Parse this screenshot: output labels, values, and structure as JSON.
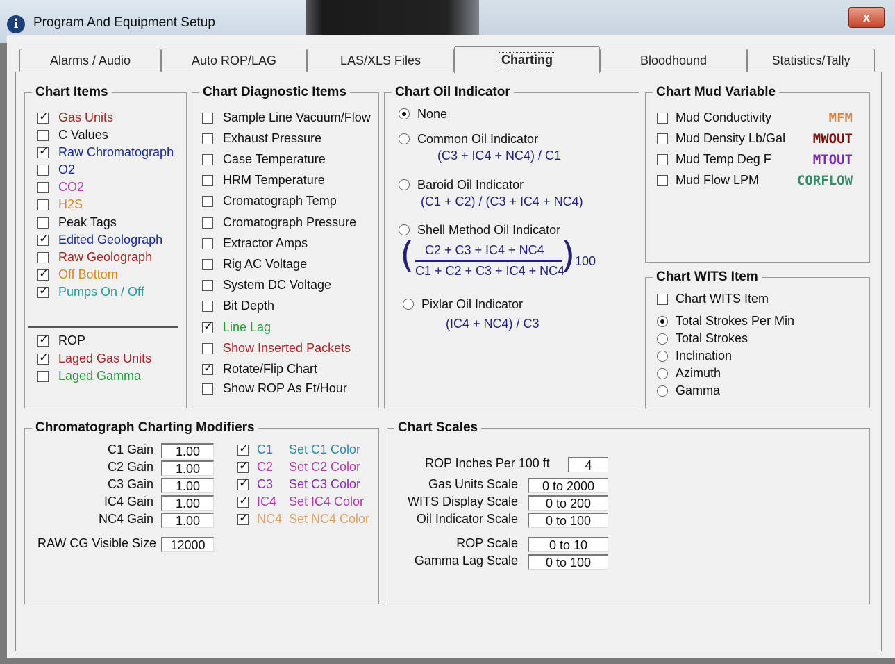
{
  "window": {
    "title": "Program And Equipment Setup",
    "close_glyph": "x"
  },
  "tabs": [
    {
      "label": "Alarms / Audio",
      "active": false
    },
    {
      "label": "Auto ROP/LAG",
      "active": false
    },
    {
      "label": "LAS/XLS Files",
      "active": false
    },
    {
      "label": "Charting",
      "active": true
    },
    {
      "label": "Bloodhound",
      "active": false
    },
    {
      "label": "Statistics/Tally",
      "active": false
    }
  ],
  "chart_items": {
    "title": "Chart Items",
    "items": [
      {
        "label": "Gas Units",
        "checked": true,
        "color": "#a02828"
      },
      {
        "label": "C Values",
        "checked": false,
        "color": "#111111"
      },
      {
        "label": "Raw Chromatograph",
        "checked": true,
        "color": "#1a2a8a"
      },
      {
        "label": "O2",
        "checked": false,
        "color": "#1a2a8a"
      },
      {
        "label": "CO2",
        "checked": false,
        "color": "#b03aa8"
      },
      {
        "label": "H2S",
        "checked": false,
        "color": "#d08a20"
      },
      {
        "label": "Peak Tags",
        "checked": false,
        "color": "#111111"
      },
      {
        "label": "Edited Geolograph",
        "checked": true,
        "color": "#1a2a8a"
      },
      {
        "label": "Raw Geolograph",
        "checked": false,
        "color": "#a02828"
      },
      {
        "label": "Off Bottom",
        "checked": true,
        "color": "#d08a20"
      },
      {
        "label": "Pumps On / Off",
        "checked": true,
        "color": "#2a9a9a"
      }
    ],
    "items2": [
      {
        "label": "ROP",
        "checked": true,
        "color": "#111111"
      },
      {
        "label": "Laged Gas Units",
        "checked": true,
        "color": "#a02828"
      },
      {
        "label": "Laged Gamma",
        "checked": false,
        "color": "#2a9a3a"
      }
    ]
  },
  "diagnostic": {
    "title": "Chart Diagnostic Items",
    "items": [
      {
        "label": "Sample Line Vacuum/Flow",
        "checked": false,
        "color": "#111111"
      },
      {
        "label": "Exhaust Pressure",
        "checked": false,
        "color": "#111111"
      },
      {
        "label": "Case Temperature",
        "checked": false,
        "color": "#111111"
      },
      {
        "label": "HRM Temperature",
        "checked": false,
        "color": "#111111"
      },
      {
        "label": "Cromatograph Temp",
        "checked": false,
        "color": "#111111"
      },
      {
        "label": "Cromatograph Pressure",
        "checked": false,
        "color": "#111111"
      },
      {
        "label": "Extractor Amps",
        "checked": false,
        "color": "#111111"
      },
      {
        "label": "Rig AC Voltage",
        "checked": false,
        "color": "#111111"
      },
      {
        "label": "System DC Voltage",
        "checked": false,
        "color": "#111111"
      },
      {
        "label": "Bit Depth",
        "checked": false,
        "color": "#111111"
      },
      {
        "label": "Line Lag",
        "checked": true,
        "color": "#2a9a3a"
      },
      {
        "label": "Show Inserted Packets",
        "checked": false,
        "color": "#a02828"
      },
      {
        "label": "Rotate/Flip Chart",
        "checked": true,
        "color": "#111111"
      },
      {
        "label": "Show ROP As Ft/Hour",
        "checked": false,
        "color": "#111111"
      }
    ]
  },
  "oil": {
    "title": "Chart Oil Indicator",
    "none_label": "None",
    "common_label": "Common Oil Indicator",
    "common_formula": "(C3 + IC4 + NC4) / C1",
    "baroid_label": "Baroid Oil Indicator",
    "baroid_formula": "(C1 + C2) / (C3 + IC4 + NC4)",
    "shell_label": "Shell Method Oil Indicator",
    "shell_num": "C2 + C3 + IC4 + NC4",
    "shell_den": "C1 + C2 + C3 + IC4 + NC4",
    "shell_mult": "100",
    "pixlar_label": "Pixlar Oil Indicator",
    "pixlar_formula": "(IC4 + NC4) / C3",
    "selected": "None"
  },
  "mud": {
    "title": "Chart Mud Variable",
    "items": [
      {
        "label": "Mud Conductivity",
        "code": "MFM",
        "code_color": "#e0853a",
        "checked": false
      },
      {
        "label": "Mud Density Lb/Gal",
        "code": "MWOUT",
        "code_color": "#7a1010",
        "checked": false
      },
      {
        "label": "Mud Temp Deg F",
        "code": "MTOUT",
        "code_color": "#7a2aaa",
        "checked": false
      },
      {
        "label": "Mud Flow LPM",
        "code": "CORFLOW",
        "code_color": "#3a8a6a",
        "checked": false
      }
    ]
  },
  "wits": {
    "title": "Chart WITS Item",
    "checkbox_label": "Chart WITS Item",
    "checked": false,
    "options": [
      "Total Strokes Per Min",
      "Total Strokes",
      "Inclination",
      "Azimuth",
      "Gamma"
    ],
    "selected": "Total Strokes Per Min"
  },
  "chromo": {
    "title": "Chromatograph Charting Modifiers",
    "gains": [
      {
        "label": "C1 Gain",
        "value": "1.00"
      },
      {
        "label": "C2 Gain",
        "value": "1.00"
      },
      {
        "label": "C3 Gain",
        "value": "1.00"
      },
      {
        "label": "IC4 Gain",
        "value": "1.00"
      },
      {
        "label": "NC4 Gain",
        "value": "1.00"
      }
    ],
    "components": [
      {
        "label": "C1",
        "set_label": "Set C1 Color",
        "checked": true,
        "color": "#2a8aa8"
      },
      {
        "label": "C2",
        "set_label": "Set C2 Color",
        "checked": true,
        "color": "#b03aa8"
      },
      {
        "label": "C3",
        "set_label": "Set C3 Color",
        "checked": true,
        "color": "#8a2aaa"
      },
      {
        "label": "IC4",
        "set_label": "Set IC4 Color",
        "checked": true,
        "color": "#b03aa8"
      },
      {
        "label": "NC4",
        "set_label": "Set NC4 Color",
        "checked": true,
        "color": "#e0a060"
      }
    ],
    "raw_label": "RAW CG Visible Size",
    "raw_value": "12000"
  },
  "scales": {
    "title": "Chart Scales",
    "rop_inches_label": "ROP Inches Per 100 ft",
    "rop_inches_value": "4",
    "rows": [
      {
        "label": "Gas Units Scale",
        "value": "0 to 2000"
      },
      {
        "label": "WITS Display Scale",
        "value": "0 to 200"
      },
      {
        "label": "Oil Indicator Scale",
        "value": "0 to 100"
      },
      {
        "label": "ROP Scale",
        "value": "0 to 10"
      },
      {
        "label": "Gamma Lag Scale",
        "value": "0 to 100"
      }
    ]
  }
}
